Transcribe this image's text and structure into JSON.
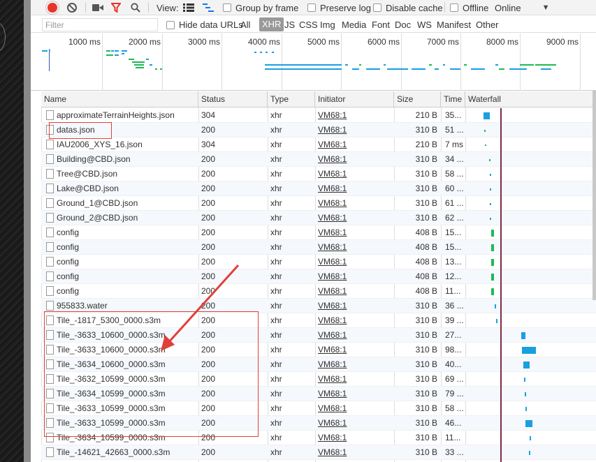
{
  "toolbar": {
    "view_label": "View:",
    "group_by_frame": "Group by frame",
    "preserve_log": "Preserve log",
    "disable_cache": "Disable cache",
    "offline": "Offline",
    "throttle": "Online"
  },
  "filter": {
    "placeholder": "Filter",
    "hide_data_urls": "Hide data URLs",
    "types": [
      "All",
      "XHR",
      "JS",
      "CSS",
      "Img",
      "Media",
      "Font",
      "Doc",
      "WS",
      "Manifest",
      "Other"
    ],
    "active_type": "XHR"
  },
  "overview": {
    "ticks": [
      "1000 ms",
      "2000 ms",
      "3000 ms",
      "4000 ms",
      "5000 ms",
      "6000 ms",
      "7000 ms",
      "8000 ms",
      "9000 ms"
    ]
  },
  "table": {
    "columns": [
      "Name",
      "Status",
      "Type",
      "Initiator",
      "Size",
      "Time",
      "Waterfall"
    ],
    "rows": [
      {
        "name": "approximateTerrainHeights.json",
        "status": "304",
        "type": "xhr",
        "initiator": "VM68:1",
        "size": "210 B",
        "time": "35..."
      },
      {
        "name": "datas.json",
        "status": "200",
        "type": "xhr",
        "initiator": "VM68:1",
        "size": "310 B",
        "time": "51 ..."
      },
      {
        "name": "IAU2006_XYS_16.json",
        "status": "304",
        "type": "xhr",
        "initiator": "VM68:1",
        "size": "210 B",
        "time": "7 ms"
      },
      {
        "name": "Building@CBD.json",
        "status": "200",
        "type": "xhr",
        "initiator": "VM68:1",
        "size": "310 B",
        "time": "34 ..."
      },
      {
        "name": "Tree@CBD.json",
        "status": "200",
        "type": "xhr",
        "initiator": "VM68:1",
        "size": "310 B",
        "time": "58 ..."
      },
      {
        "name": "Lake@CBD.json",
        "status": "200",
        "type": "xhr",
        "initiator": "VM68:1",
        "size": "310 B",
        "time": "60 ..."
      },
      {
        "name": "Ground_1@CBD.json",
        "status": "200",
        "type": "xhr",
        "initiator": "VM68:1",
        "size": "310 B",
        "time": "61 ..."
      },
      {
        "name": "Ground_2@CBD.json",
        "status": "200",
        "type": "xhr",
        "initiator": "VM68:1",
        "size": "310 B",
        "time": "62 ..."
      },
      {
        "name": "config",
        "status": "200",
        "type": "xhr",
        "initiator": "VM68:1",
        "size": "408 B",
        "time": "15..."
      },
      {
        "name": "config",
        "status": "200",
        "type": "xhr",
        "initiator": "VM68:1",
        "size": "408 B",
        "time": "15..."
      },
      {
        "name": "config",
        "status": "200",
        "type": "xhr",
        "initiator": "VM68:1",
        "size": "408 B",
        "time": "13..."
      },
      {
        "name": "config",
        "status": "200",
        "type": "xhr",
        "initiator": "VM68:1",
        "size": "408 B",
        "time": "12..."
      },
      {
        "name": "config",
        "status": "200",
        "type": "xhr",
        "initiator": "VM68:1",
        "size": "408 B",
        "time": "11..."
      },
      {
        "name": "955833.water",
        "status": "200",
        "type": "xhr",
        "initiator": "VM68:1",
        "size": "310 B",
        "time": "36 ..."
      },
      {
        "name": "Tile_-1817_5300_0000.s3m",
        "status": "200",
        "type": "xhr",
        "initiator": "VM68:1",
        "size": "310 B",
        "time": "39 ..."
      },
      {
        "name": "Tile_-3633_10600_0000.s3m",
        "status": "200",
        "type": "xhr",
        "initiator": "VM68:1",
        "size": "310 B",
        "time": "27..."
      },
      {
        "name": "Tile_-3633_10600_0000.s3m",
        "status": "200",
        "type": "xhr",
        "initiator": "VM68:1",
        "size": "310 B",
        "time": "98..."
      },
      {
        "name": "Tile_-3634_10600_0000.s3m",
        "status": "200",
        "type": "xhr",
        "initiator": "VM68:1",
        "size": "310 B",
        "time": "40..."
      },
      {
        "name": "Tile_-3632_10599_0000.s3m",
        "status": "200",
        "type": "xhr",
        "initiator": "VM68:1",
        "size": "310 B",
        "time": "69 ..."
      },
      {
        "name": "Tile_-3634_10599_0000.s3m",
        "status": "200",
        "type": "xhr",
        "initiator": "VM68:1",
        "size": "310 B",
        "time": "79 ..."
      },
      {
        "name": "Tile_-3633_10599_0000.s3m",
        "status": "200",
        "type": "xhr",
        "initiator": "VM68:1",
        "size": "310 B",
        "time": "58 ..."
      },
      {
        "name": "Tile_-3633_10599_0000.s3m",
        "status": "200",
        "type": "xhr",
        "initiator": "VM68:1",
        "size": "310 B",
        "time": "46..."
      },
      {
        "name": "Tile_-3634_10599_0000.s3m",
        "status": "200",
        "type": "xhr",
        "initiator": "VM68:1",
        "size": "310 B",
        "time": "11..."
      },
      {
        "name": "Tile_-14621_42663_0000.s3m",
        "status": "200",
        "type": "xhr",
        "initiator": "VM68:1",
        "size": "310 B",
        "time": "33 ..."
      }
    ]
  },
  "colors": {
    "record": "#e8352b",
    "waterfall_download": "#1a9fe0",
    "waterfall_waiting": "#1db954",
    "annotation": "#e0403a",
    "dom_loaded_line": "#7d2a44"
  }
}
